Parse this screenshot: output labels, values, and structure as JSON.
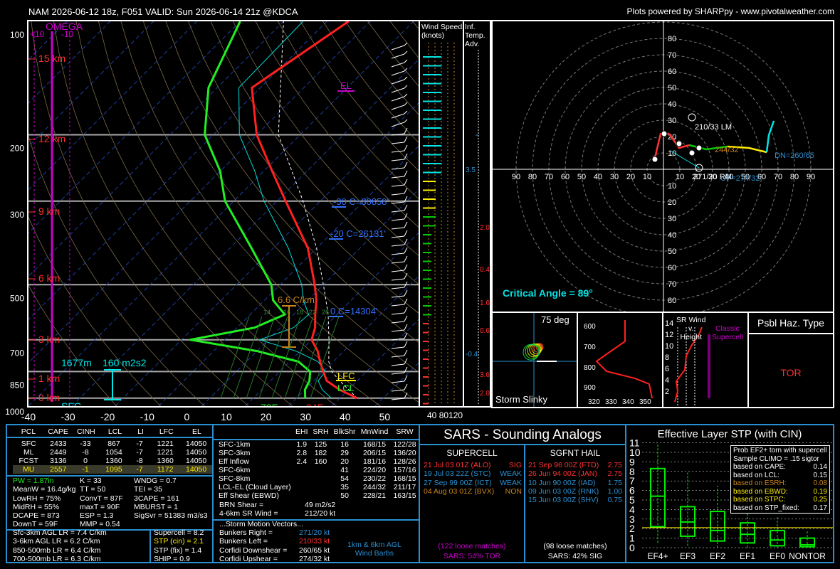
{
  "header": {
    "title": "NAM 2026-06-12 18z, F051  VALID: Sun 2026-06-14 21z @KDCA",
    "credit": "Plots powered by SHARPpy - www.pivotalweather.com"
  },
  "skewt": {
    "pressure_ticks": [
      "100",
      "200",
      "300",
      "500",
      "700",
      "850",
      "1000"
    ],
    "temp_ticks": [
      "-40",
      "-30",
      "-20",
      "-10",
      "0",
      "10",
      "20",
      "30",
      "40",
      "50"
    ],
    "omega_label": "OMEGA",
    "omega_plus": "+10",
    "omega_minus": "-10",
    "height_labels": [
      "15 km",
      "12 km",
      "9 km",
      "6 km",
      "3 km",
      "1 km",
      "0 km"
    ],
    "sfc_label": "SFC",
    "el_label": "EL",
    "lfc_label": "LFC",
    "lcl_label": "LCL",
    "m30_label": "-30 C=30858'",
    "m20_label": "-20 C=26131'",
    "zero_label": "0 C=14304'",
    "lapse_label": "6.6 C/km",
    "lapse_ticks": [
      "16",
      "18",
      "22",
      "26"
    ],
    "lapse_first": "14",
    "eff_height": "1677m",
    "eff_srh": "160 m2s2",
    "sfc_t": "94F",
    "sfc_td": "72F"
  },
  "wind_speed": {
    "title": "Wind Speed\n(knots)",
    "title1": "Wind Speed",
    "title2": "(knots)",
    "ticks": [
      "40",
      "80",
      "120"
    ]
  },
  "inf_temp": {
    "title1": "Inf.",
    "title2": "Temp.",
    "title3": "Adv.",
    "values": [
      "3.5",
      "2.0",
      "0.4",
      "1.6",
      "0.6",
      "-0.4",
      "3.6",
      "2.0"
    ]
  },
  "hodograph": {
    "ring_labels": [
      "80",
      "70",
      "60",
      "50",
      "40",
      "30",
      "20",
      "10"
    ],
    "axis_labels": [
      "90",
      "80",
      "70",
      "60",
      "50",
      "40",
      "30",
      "20",
      "10"
    ],
    "right_labels": [
      "10",
      "20",
      "30",
      "40",
      "50",
      "60",
      "70",
      "80",
      "90"
    ],
    "lm_label": "210/33 LM",
    "rm_label": "271/20 RM",
    "mean_label": "244/32",
    "dn_label": "DN=260/65",
    "up_label": "UP=274/32",
    "critical_angle": "Critical Angle = 89°",
    "markers": [
      "0",
      "2",
      "4",
      "6",
      "9"
    ]
  },
  "slinky": {
    "deg": "75 deg",
    "label": "Storm Slinky"
  },
  "theta_e": {
    "y_ticks": [
      "600",
      "700",
      "800",
      "900"
    ],
    "x_ticks": [
      "320",
      "330",
      "340",
      "350"
    ]
  },
  "srwind": {
    "title1": "SR Wind",
    "title2": "v.",
    "title3": "Height",
    "classic1": "Classic",
    "classic2": "Supercell",
    "y_ticks": [
      "14",
      "12",
      "10",
      "8",
      "6",
      "4",
      "2"
    ]
  },
  "haz": {
    "title": "Psbl Haz. Type",
    "value": "TOR"
  },
  "parcels": {
    "headers": [
      "PCL",
      "CAPE",
      "CINH",
      "LCL",
      "LI",
      "LFC",
      "EL"
    ],
    "rows": [
      [
        "SFC",
        "2433",
        "-33",
        "867",
        "-7",
        "1221",
        "14050"
      ],
      [
        "ML",
        "2449",
        "-8",
        "1054",
        "-7",
        "1221",
        "14050"
      ],
      [
        "FCST",
        "3136",
        "0",
        "1360",
        "-8",
        "1360",
        "14050"
      ],
      [
        "MU",
        "2557",
        "-1",
        "1095",
        "-7",
        "1172",
        "14050"
      ]
    ]
  },
  "indices_left": [
    "PW = 1.87in",
    "MeanW = 16.4g/kg",
    "LowRH = 75%",
    "MidRH = 55%",
    "DCAPE = 873",
    "DownT = 59F"
  ],
  "indices_mid": [
    "K = 33",
    "TT = 50",
    "ConvT = 87F",
    "maxT = 90F",
    "ESP = 1.3",
    "MMP = 0.54"
  ],
  "indices_right": [
    "WNDG = 0.7",
    "TEI = 35",
    "3CAPE = 161",
    "MBURST = 1",
    "",
    "SigSvr = 51383 m3/s3"
  ],
  "lapse_rates": [
    "Sfc-3km AGL LR = 7.4 C/km",
    "3-6km AGL LR = 6.2 C/km",
    "850-500mb LR = 6.4 C/km",
    "700-500mb LR = 6.3 C/km"
  ],
  "composites": [
    "Supercell = 8.2",
    "STP (cin) = 2.1",
    "STP (fix) = 1.4",
    "SHIP = 0.9"
  ],
  "kinematics": {
    "headers": [
      "EHI",
      "SRH",
      "BlkShr",
      "MnWind",
      "SRW"
    ],
    "rows": [
      [
        "SFC-1km",
        "1.9",
        "125",
        "16",
        "168/15",
        "122/28"
      ],
      [
        "SFC-3km",
        "2.8",
        "182",
        "29",
        "206/15",
        "136/20"
      ],
      [
        "Eff Inflow",
        "2.4",
        "160",
        "20",
        "181/16",
        "128/26"
      ],
      [
        "",
        "",
        "",
        "",
        "",
        ""
      ],
      [
        "SFC-6km",
        "",
        "",
        "41",
        "224/20",
        "157/16"
      ],
      [
        "SFC-8km",
        "",
        "",
        "54",
        "230/22",
        "168/15"
      ],
      [
        "LCL-EL (Cloud Layer)",
        "",
        "",
        "35",
        "244/32",
        "211/17"
      ],
      [
        "Eff Shear (EBWD)",
        "",
        "",
        "50",
        "228/21",
        "163/15"
      ]
    ],
    "brn": "BRN Shear =",
    "brn_val": "49 m2/s2",
    "srw": "4-6km SR Wind =",
    "srw_val": "212/20 kt",
    "motion_title": "...Storm Motion Vectors...",
    "motions": [
      [
        "Bunkers Right =",
        "271/20 kt"
      ],
      [
        "Bunkers Left =",
        "210/33 kt"
      ],
      [
        "Corfidi Downshear =",
        "260/65 kt"
      ],
      [
        "Corfidi Upshear =",
        "274/32 kt"
      ]
    ],
    "barbs1": "1km & 6km AGL",
    "barbs2": "Wind Barbs"
  },
  "sars": {
    "title": "SARS - Sounding Analogs",
    "super_title": "SUPERCELL",
    "hail_title": "SGFNT HAIL",
    "super_rows": [
      [
        "21 Jul 03 01Z (ALO)",
        "SIG"
      ],
      [
        "19 Jul 03 22Z (STC)",
        "WEAK"
      ],
      [
        "27 Sep 99 00Z (ICT)",
        "WEAK"
      ],
      [
        "04 Aug 03 01Z (BVX)",
        "NON"
      ]
    ],
    "hail_rows": [
      [
        "21 Sep 96 00Z (FTD)",
        "2.75"
      ],
      [
        "26 Jun 94 00Z (JAN)",
        "2.75"
      ],
      [
        "10 Jun 90 00Z (IAD)",
        "1.75"
      ],
      [
        "09 Jun 03 00Z (RNK)",
        "1.00"
      ],
      [
        "15 Jun 03 00Z (SHV)",
        "0.75"
      ]
    ],
    "super_matches": "(122 loose matches)",
    "super_pct": "SARS: 54% TOR",
    "hail_matches": "(98 loose matches)",
    "hail_pct": "SARS: 42% SIG"
  },
  "stp": {
    "title": "Effective Layer STP (with CIN)",
    "y_ticks": [
      "0",
      "1",
      "2",
      "3",
      "4",
      "5",
      "6",
      "7",
      "8",
      "9",
      "10",
      "11"
    ],
    "categories": [
      "EF4+",
      "EF3",
      "EF2",
      "EF1",
      "EF0",
      "NONTOR"
    ],
    "prob_title": "Prob EF2+ torn with supercell",
    "climo": "Sample CLIMO = .15 sigtor",
    "probs": [
      [
        "based on CAPE:",
        "0.14"
      ],
      [
        "based on LCL:",
        "0.15"
      ],
      [
        "based on ESRH:",
        "0.08"
      ],
      [
        "based on EBWD:",
        "0.19"
      ],
      [
        "based on STPC:",
        "0.25"
      ],
      [
        "based on STP_fixed:",
        "0.17"
      ]
    ]
  },
  "colors": {
    "temp": "#ff2020",
    "dewp": "#22ee22",
    "wetbulb": "#00dddd",
    "accent_blue": "#2a8fd0",
    "magenta": "#cc00cc"
  },
  "chart_data": [
    {
      "type": "line",
      "title": "",
      "xlabel": "",
      "ylabel": "",
      "ylim": [
        1000,
        100
      ],
      "xlim": [
        -40,
        50
      ],
      "series": [
        {
          "pressure": [
            1000,
            950,
            900,
            850,
            800,
            750,
            700,
            650,
            600,
            550,
            500,
            400,
            300,
            250,
            200,
            150,
            100
          ],
          "values": [
            34,
            28,
            23,
            20,
            17,
            14,
            10,
            8,
            5,
            2,
            -2,
            -12,
            -28,
            -38,
            -50,
            -62,
            -55
          ]
        },
        {
          "pressure": [
            1000,
            950,
            900,
            850,
            800,
            750,
            700,
            650,
            600,
            550,
            500,
            400,
            300,
            250,
            200,
            150,
            100
          ],
          "values": [
            22,
            20,
            19,
            17,
            12,
            0,
            -18,
            -6,
            -2,
            -8,
            -12,
            -25,
            -42,
            -50,
            -62,
            -72,
            -80
          ]
        }
      ]
    },
    {
      "type": "bar",
      "title": "Effective Layer STP (with CIN)",
      "categories": [
        "EF4+",
        "EF3",
        "EF2",
        "EF1",
        "EF0",
        "NONTOR"
      ],
      "ylim": [
        0,
        11
      ],
      "series": [
        {
          "name": "median",
          "values": [
            5.4,
            2.7,
            1.8,
            1.4,
            0.8,
            0.3
          ]
        }
      ]
    }
  ]
}
